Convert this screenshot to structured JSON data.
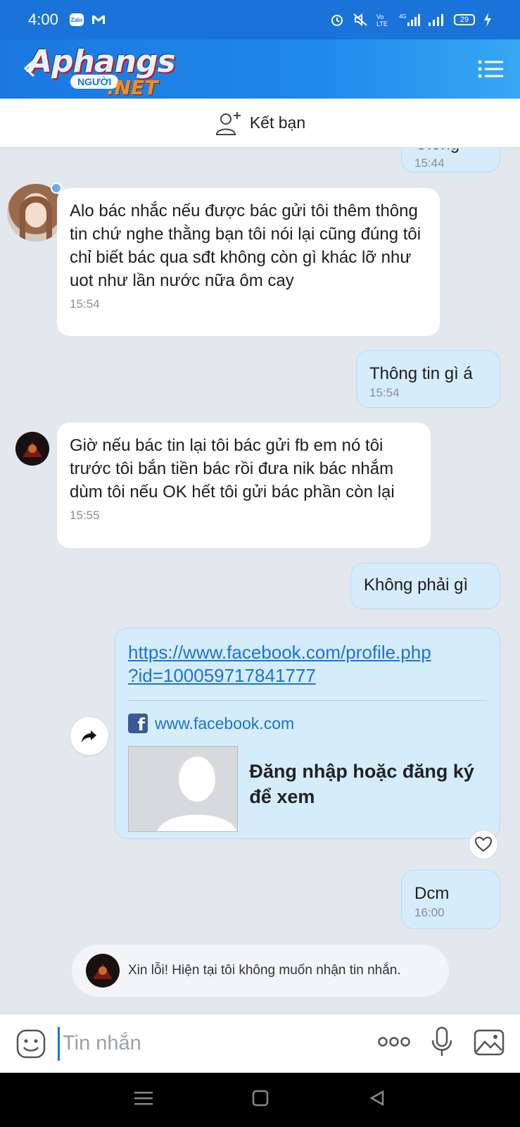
{
  "status_bar": {
    "time": "4:00",
    "battery": "29",
    "network": "4G"
  },
  "header": {
    "logo_main": "Aphangs",
    "logo_nguoi": "NGƯỜI",
    "logo_net": ".NET"
  },
  "add_friend": {
    "label": "Kết bạn"
  },
  "messages": [
    {
      "id": "partial",
      "direction": "out",
      "text": "Giống",
      "time": "15:44"
    },
    {
      "id": "m1",
      "direction": "in",
      "text": "Alo bác nhắc nếu được bác gửi tôi thêm thông tin chứ nghe thằng bạn tôi nói lại cũng đúng tôi chỉ biết bác qua sđt không còn gì khác lỡ như uot như lần nước nữa ôm cay",
      "time": "15:54"
    },
    {
      "id": "m2",
      "direction": "out",
      "text": "Thông tin gì á",
      "time": "15:54"
    },
    {
      "id": "m3",
      "direction": "in",
      "text": "Giờ nếu bác tin lại tôi bác gửi fb em nó tôi trước tôi bắn tiền bác rồi đưa nik bác nhắm dùm tôi nếu OK hết tôi gửi bác phần còn lại",
      "time": "15:55"
    },
    {
      "id": "m4",
      "direction": "out",
      "text": "Không phải gì",
      "time": ""
    },
    {
      "id": "m6",
      "direction": "out",
      "text": "Dcm",
      "time": "16:00"
    }
  ],
  "link_card": {
    "url_line1": "https://www.facebook.com/profile.php",
    "url_line2": "?id=100059717841777",
    "domain": "www.facebook.com",
    "fb_letter": "f",
    "title": "Đăng nhập hoặc đăng ký để xem"
  },
  "system_notice": {
    "text": "Xin lỗi! Hiện tại tôi không muốn nhận tin nhắn."
  },
  "input": {
    "placeholder": "Tin nhắn",
    "value": ""
  },
  "colors": {
    "accent": "#1a73d9",
    "chat_bg": "#e3e8ef",
    "bubble_out": "#d5ecfb",
    "bubble_in": "#ffffff"
  }
}
